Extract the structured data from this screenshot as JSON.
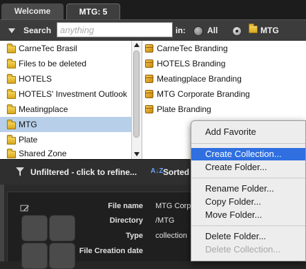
{
  "tabs": [
    {
      "label": "Welcome"
    },
    {
      "label": "MTG: 5"
    }
  ],
  "search": {
    "label": "Search",
    "placeholder": "anything",
    "in_label": "in:",
    "scope_all": "All",
    "scope_collection": "MTG"
  },
  "left_list": {
    "items": [
      {
        "label": "CarneTec Brasil"
      },
      {
        "label": "Files to be deleted"
      },
      {
        "label": "HOTELS"
      },
      {
        "label": "HOTELS' Investment Outlook"
      },
      {
        "label": "Meatingplace"
      },
      {
        "label": "MTG"
      },
      {
        "label": "Plate"
      },
      {
        "label": "Shared Zone"
      }
    ],
    "selected": "MTG"
  },
  "right_list": {
    "items": [
      {
        "label": "CarneTec Branding"
      },
      {
        "label": "HOTELS Branding"
      },
      {
        "label": "Meatingplace Branding"
      },
      {
        "label": "MTG Corporate Branding"
      },
      {
        "label": "Plate Branding"
      }
    ]
  },
  "filter": {
    "label": "Unfiltered - click to refine...",
    "sort_label": "Sorted",
    "sort_icon": "A↓Z"
  },
  "details": {
    "fields": [
      {
        "label": "File name",
        "value": "MTG Corpo"
      },
      {
        "label": "Directory",
        "value": "/MTG"
      },
      {
        "label": "Type",
        "value": "collection"
      },
      {
        "label": "File Creation date",
        "value": ""
      }
    ]
  },
  "context_menu": {
    "add_favorite": "Add Favorite",
    "create_collection": "Create Collection...",
    "create_folder": "Create Folder...",
    "rename_folder": "Rename Folder...",
    "copy_folder": "Copy Folder...",
    "move_folder": "Move Folder...",
    "delete_folder": "Delete Folder...",
    "delete_collection": "Delete Collection...",
    "highlighted": "Create Collection...",
    "disabled": [
      "Delete Collection..."
    ]
  },
  "colors": {
    "selection": "#b7cfe8",
    "menu_highlight": "#2f6fe0",
    "folder": "#e9c03a"
  }
}
